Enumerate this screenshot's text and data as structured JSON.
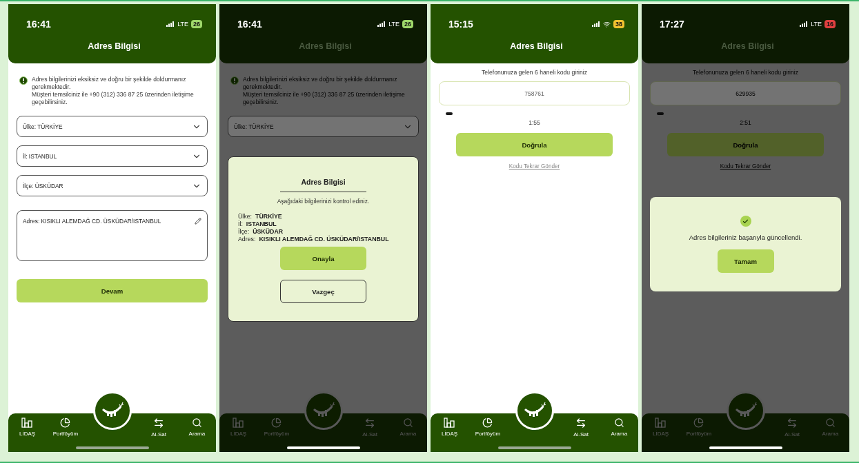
{
  "screens": [
    {
      "status": {
        "time": "16:41",
        "network": {
          "kind": "cellular",
          "label": "LTE"
        },
        "battery": {
          "text": "26",
          "color": "#9fd86a"
        }
      },
      "title": "Adres Bilgisi",
      "dimmed": false,
      "content": {
        "kind": "address_form",
        "notice": [
          "Adres bilgilerinizi eksiksiz ve doğru bir şekilde doldurmanız gerekmektedir.",
          "Müşteri temsilciniz ile +90 (312) 336 87 25 üzerinden iletişime geçebilirsiniz."
        ],
        "fields": [
          {
            "kind": "select",
            "text": "Ülke: TÜRKİYE"
          },
          {
            "kind": "select",
            "text": "İl: ISTANBUL"
          },
          {
            "kind": "select",
            "text": "İlçe: ÜSKÜDAR"
          },
          {
            "kind": "textarea",
            "text": "Adres: KISIKLI ALEMDAĞ CD. ÜSKÜDAR/ISTANBUL"
          }
        ],
        "button": "Devam"
      },
      "tab_bar": {
        "items": [
          "LİDAŞ",
          "Portföyüm",
          "Al-Sat",
          "Arama"
        ]
      }
    },
    {
      "status": {
        "time": "16:41",
        "network": {
          "kind": "cellular",
          "label": "LTE"
        },
        "battery": {
          "text": "26",
          "color": "#9fd86a"
        }
      },
      "title": "Adres Bilgisi",
      "dimmed": true,
      "content": {
        "kind": "address_form",
        "notice": [
          "Adres bilgilerinizi eksiksiz ve doğru bir şekilde doldurmanız gerekmektedir.",
          "Müşteri temsilciniz ile +90 (312) 336 87 25 üzerinden iletişime geçebilirsiniz."
        ],
        "fields": [
          {
            "kind": "select",
            "text": "Ülke: TÜRKİYE"
          }
        ]
      },
      "modal": {
        "kind": "confirm",
        "title": "Adres Bilgisi",
        "subtitle": "Aşağıdaki bilgilerinizi kontrol ediniz.",
        "details": [
          {
            "label": "Ülke:",
            "value": "TÜRKİYE"
          },
          {
            "label": "İl:",
            "value": "ISTANBUL"
          },
          {
            "label": "İlçe:",
            "value": "ÜSKÜDAR"
          },
          {
            "label": "Adres:",
            "value": "KISIKLI ALEMDAĞ CD. ÜSKÜDAR/ISTANBUL"
          }
        ],
        "buttons": [
          {
            "label": "Onayla",
            "kind": "primary"
          },
          {
            "label": "Vazgeç",
            "kind": "secondary"
          }
        ]
      },
      "tab_bar": {
        "items": [
          "LİDAŞ",
          "Portföyüm",
          "Al-Sat",
          "Arama"
        ]
      }
    },
    {
      "status": {
        "time": "15:15",
        "network": {
          "kind": "wifi"
        },
        "battery": {
          "text": "38",
          "color": "#f2c230"
        }
      },
      "title": "Adres Bilgisi",
      "dimmed": false,
      "content": {
        "kind": "otp",
        "instruction": "Telefonunuza gelen 6 haneli kodu giriniz",
        "code": "758761",
        "timer": "1:55",
        "button": "Doğrula",
        "link": "Kodu Tekrar Gönder"
      },
      "tab_bar": {
        "items": [
          "LİDAŞ",
          "Portföyüm",
          "Al-Sat",
          "Arama"
        ]
      }
    },
    {
      "status": {
        "time": "17:27",
        "network": {
          "kind": "cellular",
          "label": "LTE"
        },
        "battery": {
          "text": "16",
          "color": "#e04040"
        }
      },
      "title": "Adres Bilgisi",
      "dimmed": true,
      "content": {
        "kind": "otp",
        "instruction": "Telefonunuza gelen 6 haneli kodu giriniz",
        "code": "629935",
        "timer": "2:51",
        "button": "Doğrula",
        "link": "Kodu Tekrar Gönder"
      },
      "modal": {
        "kind": "success",
        "message": "Adres bilgileriniz başarıyla güncellendi.",
        "buttons": [
          {
            "label": "Tamam",
            "kind": "primary"
          }
        ]
      },
      "tab_bar": {
        "items": [
          "LİDAŞ",
          "Portföyüm",
          "Al-Sat",
          "Arama"
        ]
      }
    }
  ]
}
